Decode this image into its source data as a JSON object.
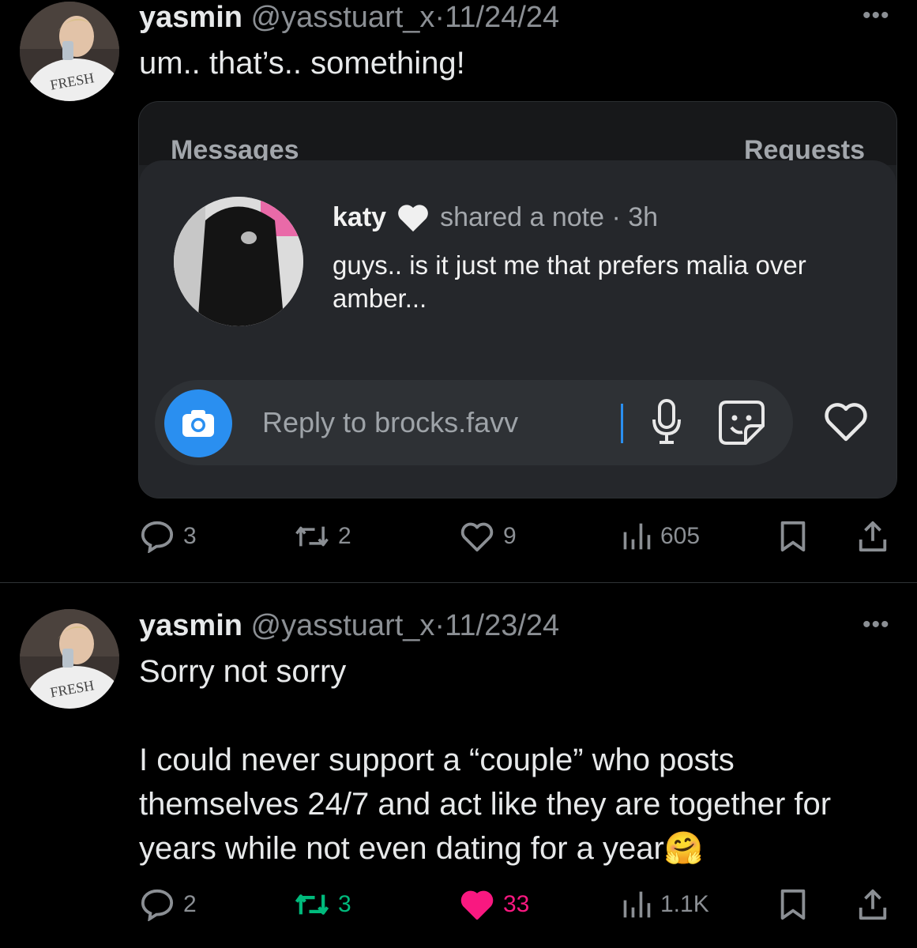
{
  "tweets": [
    {
      "author": "yasmin",
      "handle": "@yasstuart_x",
      "date_sep": "·",
      "date": "11/24/24",
      "more": "•••",
      "text": "um.. that’s.. something!",
      "embed": {
        "tab_left": "Messages",
        "tab_right": "Requests",
        "note_author": "katy",
        "note_meta": "shared a note · 3h",
        "note_text": "guys.. is it just me that prefers malia over amber...",
        "reply_placeholder": "Reply to brocks.favv"
      },
      "stats": {
        "replies": "3",
        "retweets": "2",
        "likes": "9",
        "views": "605"
      },
      "liked": false,
      "retweeted": false
    },
    {
      "author": "yasmin",
      "handle": "@yasstuart_x",
      "date_sep": "·",
      "date": "11/23/24",
      "more": "•••",
      "text_line1": "Sorry not sorry",
      "text_para2": "I could never support a “couple” who posts themselves 24/7 and act like they are together for years while not even dating for a year",
      "text_emoji": "🤗",
      "stats": {
        "replies": "2",
        "retweets": "3",
        "likes": "33",
        "views": "1.1K"
      },
      "liked": true,
      "retweeted": true
    }
  ],
  "colors": {
    "background": "#000000",
    "text": "#e7e9ea",
    "muted": "#8b8f94",
    "like_active": "#f91880",
    "retweet_active": "#00ba7c",
    "camera_blue": "#2a8ff0"
  },
  "icons": [
    "reply-icon",
    "retweet-icon",
    "like-icon",
    "views-icon",
    "bookmark-icon",
    "share-icon",
    "camera-icon",
    "microphone-icon",
    "sticker-icon",
    "heart-icon",
    "white-heart-icon"
  ]
}
